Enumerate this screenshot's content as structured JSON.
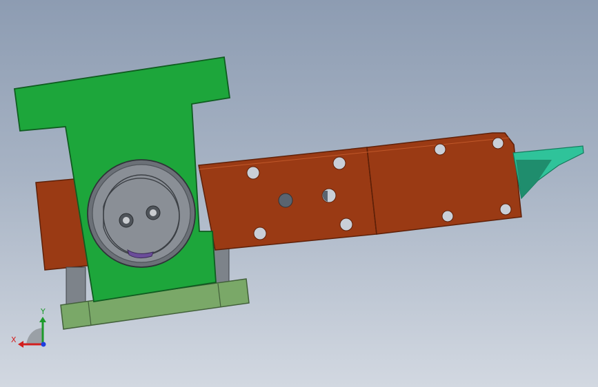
{
  "viewport": {
    "background_top": "#8d9cb2",
    "background_bottom": "#d2d8e1"
  },
  "model": {
    "colors": {
      "green_block": "#1da63b",
      "rust_plate": "#9a3a14",
      "rust_edge": "#5e2008",
      "base_plate": "#7aa868",
      "teal_blade": "#2fc39a",
      "disc": "#8a8f96",
      "disc_dark": "#4f545a",
      "post": "#7d838a",
      "purple_key": "#6b4c9a"
    }
  },
  "triad": {
    "x_label": "X",
    "y_label": "Y",
    "x_color": "#d21e1e",
    "y_color": "#1c9a2a",
    "z_color": "#1e3ee0"
  }
}
